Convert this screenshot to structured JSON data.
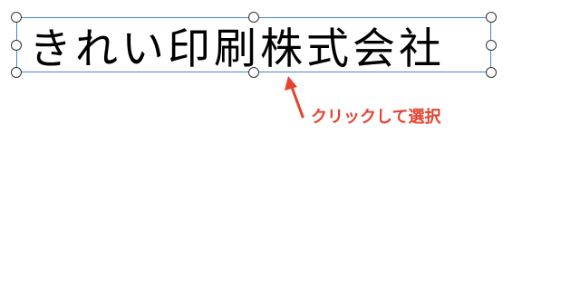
{
  "text_frame": {
    "content": "きれい印刷株式会社"
  },
  "annotation": {
    "label": "クリックして選択",
    "color": "#e8412e"
  },
  "selection": {
    "border_color": "#4a7fe0",
    "handle_color": "#333333"
  }
}
